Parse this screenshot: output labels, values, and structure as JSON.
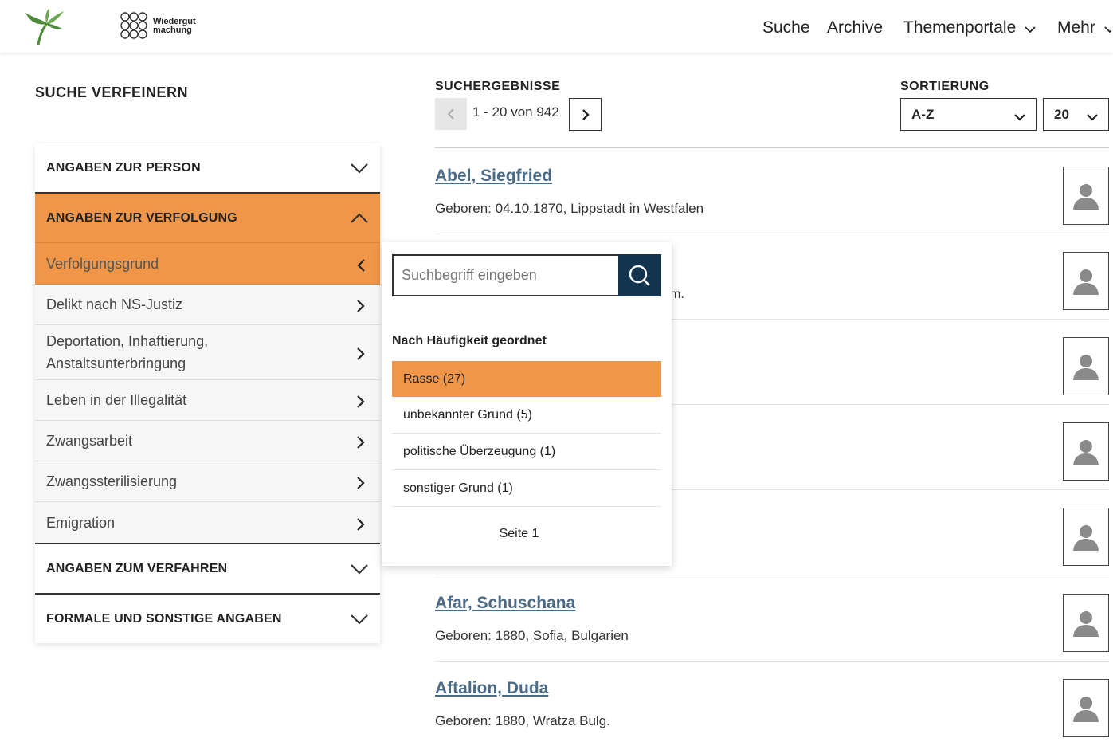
{
  "header": {
    "logo_text_line1": "Wiedergut",
    "logo_text_line2": "machung",
    "nav": [
      "Suche",
      "Archive",
      "Themenportale",
      "Mehr"
    ]
  },
  "sidebar": {
    "title": "SUCHE VERFEINERN",
    "sections": {
      "person": "ANGABEN ZUR PERSON",
      "verfolgung": "ANGABEN ZUR VERFOLGUNG",
      "verfahren": "ANGABEN ZUM VERFAHREN",
      "formal": "FORMALE UND SONSTIGE ANGABEN"
    },
    "items": [
      "Verfolgungsgrund",
      "Delikt nach NS-Justiz",
      "Deportation, Inhaftierung, Anstaltsunterbringung",
      "Leben in der Illegalität",
      "Zwangsarbeit",
      "Zwangssterilisierung",
      "Emigration"
    ]
  },
  "results": {
    "label": "SUCHERGEBNISSE",
    "pagination": "1 - 20 von 942",
    "sort_label": "SORTIERUNG",
    "sort_value": "A-Z",
    "per_page": "20",
    "rows": [
      {
        "name": "Abel, Siegfried",
        "born": "Geboren: 04.10.1870, Lippstadt in Westfalen"
      },
      {
        "name": "Afar, Schuschana",
        "born": "Geboren: 1880, Sofia, Bulgarien"
      },
      {
        "name": "Aftalion, Duda",
        "born": "Geboren: 1880, Wratza Bulg."
      }
    ],
    "partial_text": "m."
  },
  "flyout": {
    "search_placeholder": "Suchbegriff eingeben",
    "heading": "Nach Häufigkeit geordnet",
    "options": [
      "Rasse (27)",
      "unbekannter Grund (5)",
      "politische Überzeugung (1)",
      "sonstiger Grund (1)"
    ],
    "page": "Seite 1"
  },
  "colors": {
    "accent": "#ef9649",
    "dark_blue": "#13344f",
    "link": "#4a6a86"
  }
}
